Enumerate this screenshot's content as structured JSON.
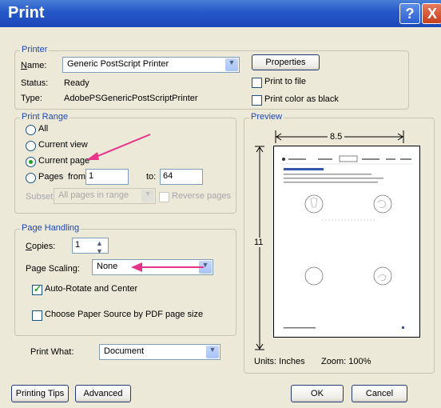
{
  "window": {
    "title": "Print",
    "help_label": "?",
    "close_label": "X"
  },
  "printer": {
    "group_label": "Printer",
    "name_label": "Name:",
    "name_value": "Generic PostScript Printer",
    "status_label": "Status:",
    "status_value": "Ready",
    "type_label": "Type:",
    "type_value": "AdobePSGenericPostScriptPrinter",
    "properties_button": "Properties",
    "print_to_file": "Print to file",
    "print_color_black": "Print color as black"
  },
  "range": {
    "group_label": "Print Range",
    "all": "All",
    "current_view": "Current view",
    "current_page": "Current page",
    "pages": "Pages",
    "from_label": "from:",
    "from_value": "1",
    "to_label": "to:",
    "to_value": "64",
    "subset_label": "Subset:",
    "subset_value": "All pages in range",
    "reverse_pages": "Reverse pages",
    "selected": "current_page"
  },
  "handling": {
    "group_label": "Page Handling",
    "copies_label": "Copies:",
    "copies_value": "1",
    "scaling_label": "Page Scaling:",
    "scaling_value": "None",
    "auto_rotate": "Auto-Rotate and Center",
    "auto_rotate_checked": true,
    "choose_paper": "Choose Paper Source by PDF page size",
    "choose_paper_checked": false
  },
  "print_what": {
    "label": "Print What:",
    "value": "Document"
  },
  "preview": {
    "group_label": "Preview",
    "width_label": "8.5",
    "height_label": "11",
    "units": "Units: Inches",
    "zoom": "Zoom: 100%"
  },
  "footer": {
    "printing_tips": "Printing Tips",
    "advanced": "Advanced",
    "ok": "OK",
    "cancel": "Cancel"
  },
  "colors": {
    "title_blue": "#2457c8",
    "annotation_pink": "#e8338a",
    "check_green": "#21a121"
  }
}
